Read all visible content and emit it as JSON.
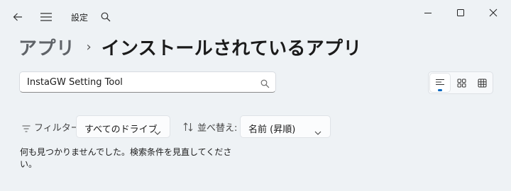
{
  "titlebar": {
    "title": "設定"
  },
  "breadcrumb": {
    "parent": "アプリ",
    "separator": "›",
    "current": "インストールされているアプリ"
  },
  "search": {
    "value": "InstaGW Setting Tool",
    "placeholder": ""
  },
  "filter": {
    "label": "フィルター:",
    "value": "すべてのドライブ"
  },
  "sort": {
    "label": "並べ替え:",
    "value": "名前 (昇順)"
  },
  "message": "何も見つかりませんでした。検索条件を見直してください。",
  "icons": {
    "back": "back-arrow-icon",
    "menu": "hamburger-menu-icon",
    "search": "search-icon",
    "minimize": "minimize-icon",
    "maximize": "maximize-icon",
    "close": "close-icon",
    "list_view": "list-view-icon",
    "grid_view": "grid-view-icon",
    "table_view": "table-view-icon",
    "filter": "filter-icon",
    "sort": "sort-icon",
    "chevron": "chevron-down-icon"
  },
  "colors": {
    "accent": "#0067c0",
    "background": "#eef2f5"
  }
}
